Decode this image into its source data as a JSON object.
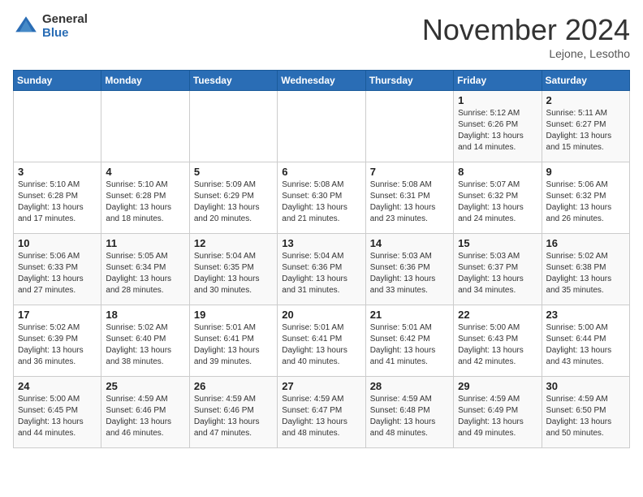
{
  "logo": {
    "general": "General",
    "blue": "Blue"
  },
  "title": "November 2024",
  "location": "Lejone, Lesotho",
  "days_of_week": [
    "Sunday",
    "Monday",
    "Tuesday",
    "Wednesday",
    "Thursday",
    "Friday",
    "Saturday"
  ],
  "weeks": [
    [
      {
        "day": "",
        "info": ""
      },
      {
        "day": "",
        "info": ""
      },
      {
        "day": "",
        "info": ""
      },
      {
        "day": "",
        "info": ""
      },
      {
        "day": "",
        "info": ""
      },
      {
        "day": "1",
        "info": "Sunrise: 5:12 AM\nSunset: 6:26 PM\nDaylight: 13 hours\nand 14 minutes."
      },
      {
        "day": "2",
        "info": "Sunrise: 5:11 AM\nSunset: 6:27 PM\nDaylight: 13 hours\nand 15 minutes."
      }
    ],
    [
      {
        "day": "3",
        "info": "Sunrise: 5:10 AM\nSunset: 6:28 PM\nDaylight: 13 hours\nand 17 minutes."
      },
      {
        "day": "4",
        "info": "Sunrise: 5:10 AM\nSunset: 6:28 PM\nDaylight: 13 hours\nand 18 minutes."
      },
      {
        "day": "5",
        "info": "Sunrise: 5:09 AM\nSunset: 6:29 PM\nDaylight: 13 hours\nand 20 minutes."
      },
      {
        "day": "6",
        "info": "Sunrise: 5:08 AM\nSunset: 6:30 PM\nDaylight: 13 hours\nand 21 minutes."
      },
      {
        "day": "7",
        "info": "Sunrise: 5:08 AM\nSunset: 6:31 PM\nDaylight: 13 hours\nand 23 minutes."
      },
      {
        "day": "8",
        "info": "Sunrise: 5:07 AM\nSunset: 6:32 PM\nDaylight: 13 hours\nand 24 minutes."
      },
      {
        "day": "9",
        "info": "Sunrise: 5:06 AM\nSunset: 6:32 PM\nDaylight: 13 hours\nand 26 minutes."
      }
    ],
    [
      {
        "day": "10",
        "info": "Sunrise: 5:06 AM\nSunset: 6:33 PM\nDaylight: 13 hours\nand 27 minutes."
      },
      {
        "day": "11",
        "info": "Sunrise: 5:05 AM\nSunset: 6:34 PM\nDaylight: 13 hours\nand 28 minutes."
      },
      {
        "day": "12",
        "info": "Sunrise: 5:04 AM\nSunset: 6:35 PM\nDaylight: 13 hours\nand 30 minutes."
      },
      {
        "day": "13",
        "info": "Sunrise: 5:04 AM\nSunset: 6:36 PM\nDaylight: 13 hours\nand 31 minutes."
      },
      {
        "day": "14",
        "info": "Sunrise: 5:03 AM\nSunset: 6:36 PM\nDaylight: 13 hours\nand 33 minutes."
      },
      {
        "day": "15",
        "info": "Sunrise: 5:03 AM\nSunset: 6:37 PM\nDaylight: 13 hours\nand 34 minutes."
      },
      {
        "day": "16",
        "info": "Sunrise: 5:02 AM\nSunset: 6:38 PM\nDaylight: 13 hours\nand 35 minutes."
      }
    ],
    [
      {
        "day": "17",
        "info": "Sunrise: 5:02 AM\nSunset: 6:39 PM\nDaylight: 13 hours\nand 36 minutes."
      },
      {
        "day": "18",
        "info": "Sunrise: 5:02 AM\nSunset: 6:40 PM\nDaylight: 13 hours\nand 38 minutes."
      },
      {
        "day": "19",
        "info": "Sunrise: 5:01 AM\nSunset: 6:41 PM\nDaylight: 13 hours\nand 39 minutes."
      },
      {
        "day": "20",
        "info": "Sunrise: 5:01 AM\nSunset: 6:41 PM\nDaylight: 13 hours\nand 40 minutes."
      },
      {
        "day": "21",
        "info": "Sunrise: 5:01 AM\nSunset: 6:42 PM\nDaylight: 13 hours\nand 41 minutes."
      },
      {
        "day": "22",
        "info": "Sunrise: 5:00 AM\nSunset: 6:43 PM\nDaylight: 13 hours\nand 42 minutes."
      },
      {
        "day": "23",
        "info": "Sunrise: 5:00 AM\nSunset: 6:44 PM\nDaylight: 13 hours\nand 43 minutes."
      }
    ],
    [
      {
        "day": "24",
        "info": "Sunrise: 5:00 AM\nSunset: 6:45 PM\nDaylight: 13 hours\nand 44 minutes."
      },
      {
        "day": "25",
        "info": "Sunrise: 4:59 AM\nSunset: 6:46 PM\nDaylight: 13 hours\nand 46 minutes."
      },
      {
        "day": "26",
        "info": "Sunrise: 4:59 AM\nSunset: 6:46 PM\nDaylight: 13 hours\nand 47 minutes."
      },
      {
        "day": "27",
        "info": "Sunrise: 4:59 AM\nSunset: 6:47 PM\nDaylight: 13 hours\nand 48 minutes."
      },
      {
        "day": "28",
        "info": "Sunrise: 4:59 AM\nSunset: 6:48 PM\nDaylight: 13 hours\nand 48 minutes."
      },
      {
        "day": "29",
        "info": "Sunrise: 4:59 AM\nSunset: 6:49 PM\nDaylight: 13 hours\nand 49 minutes."
      },
      {
        "day": "30",
        "info": "Sunrise: 4:59 AM\nSunset: 6:50 PM\nDaylight: 13 hours\nand 50 minutes."
      }
    ]
  ]
}
